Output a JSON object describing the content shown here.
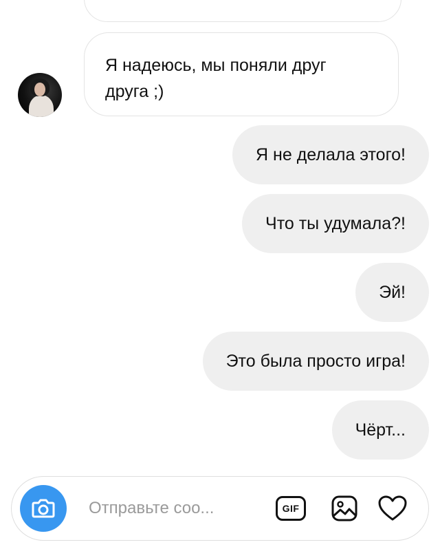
{
  "messages": [
    {
      "direction": "incoming",
      "lines": [
        "Я надеюсь, мы поняли друг",
        "друга ;)"
      ]
    },
    {
      "direction": "outgoing",
      "text": "Я не делала этого!"
    },
    {
      "direction": "outgoing",
      "text": "Что ты удумала?!"
    },
    {
      "direction": "outgoing",
      "text": "Эй!"
    },
    {
      "direction": "outgoing",
      "text": "Это была просто игра!"
    },
    {
      "direction": "outgoing",
      "text": "Чёрт..."
    }
  ],
  "composer": {
    "placeholder": "Отправьте соо...",
    "value": "",
    "gif_label": "GIF",
    "icons": [
      "camera-icon",
      "gif-icon",
      "gallery-icon",
      "heart-icon"
    ]
  },
  "colors": {
    "accent": "#3897f0",
    "outgoing_bubble": "#efefef",
    "incoming_border": "#e3e3e3",
    "placeholder": "#9a9a9a"
  }
}
